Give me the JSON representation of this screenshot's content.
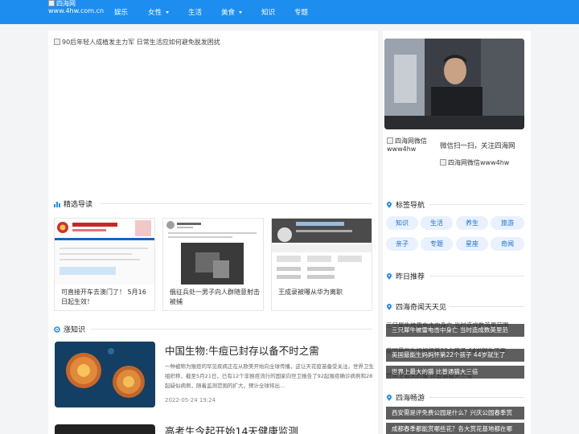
{
  "header": {
    "logo_alt_line1": "四海网",
    "logo_alt_line2": "www.4hw.com.cn",
    "nav": [
      {
        "label": "娱乐"
      },
      {
        "label": "女性"
      },
      {
        "label": "生活"
      },
      {
        "label": "美食"
      },
      {
        "label": "知识"
      },
      {
        "label": "专题"
      }
    ]
  },
  "hero": {
    "alt": "90后年轻人成植发主力军 日常生活应如何避免脱发困扰"
  },
  "featured": {
    "title": "精选导读",
    "items": [
      {
        "caption": "可直接开车去澳门了！ 5月16日起生效！"
      },
      {
        "caption": "俄征兵处一男子向人群随意射击被捕"
      },
      {
        "caption": "王成录被曝从华为离职"
      }
    ]
  },
  "knowledge": {
    "title": "涨知识",
    "articles": [
      {
        "title": "中国生物:牛痘已封存以备不时之需",
        "summary": "一种被称为猴痘的罕见疾病正在从欧美开始向全球传播，这让天花疫苗备受关注。世界卫生组织称，截至5月21日，已有12个非猴痘流行的国家向世卫报告了92起猴痘确诊病例和28起疑似病例，随着监测范围的扩大，预计全球将出...",
        "date": "2022-05-24 19:24"
      },
      {
        "title": "高考生今起开始14天健康监测"
      }
    ]
  },
  "sidebar": {
    "qr_alt_line1": "四海网微信",
    "qr_alt_line2": "www4hw",
    "wx_text": "微信扫一扫，关注四海网",
    "wx_img_alt": "四海网微信www4hw",
    "tag_nav_title": "标签导航",
    "tags": [
      {
        "label": "知识"
      },
      {
        "label": "生活"
      },
      {
        "label": "养生"
      },
      {
        "label": "旅游"
      },
      {
        "label": "亲子"
      },
      {
        "label": "专题"
      },
      {
        "label": "星座"
      },
      {
        "label": "奇闻"
      }
    ],
    "recommend_title": "昨日推荐",
    "wonders_title": "四海奇闻天天见",
    "wonders": [
      {
        "text": "三只犀牛被雷电击中身亡 当时造成数英里范"
      },
      {
        "text": "英国最能生妈妈怀第22个孩子 44岁就生了"
      },
      {
        "text": "世界上最大的猫 比普通猫大三倍"
      }
    ],
    "wonders_ghost": [
      {
        "text": "三只犀牛被雷电击中身亡 当时造成数英里范围"
      },
      {
        "text": "英国最能生妈妈怀第22个孩子 44岁就生了两"
      },
      {
        "text": "世界上最大的猫 比普通猫大三倍"
      }
    ],
    "hot_title": "四海畅游",
    "hot": [
      {
        "text": "西安需是评免费公园是什么？兴庆公园春季赏"
      },
      {
        "text": "成都春季都能赏哪些花？各大赏花基地都在哪"
      }
    ]
  },
  "colors": {
    "brand": "#1d8df0",
    "tag_bg": "#e8f1fd",
    "tag_text": "#1d70d0"
  }
}
